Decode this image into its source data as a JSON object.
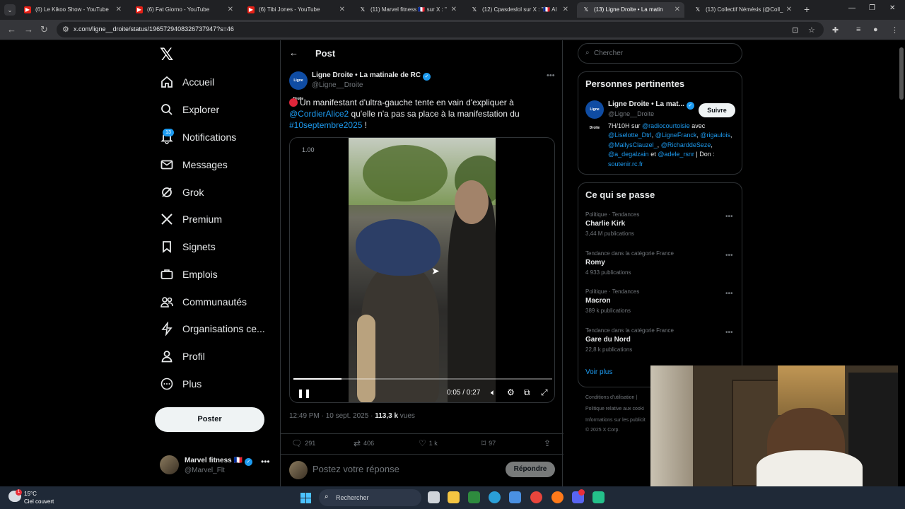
{
  "browser": {
    "tabs": [
      {
        "title": "(6) Le Kikoo Show - YouTube",
        "favicon_color": "#e62117"
      },
      {
        "title": "(6) Fat Giorno - YouTube",
        "favicon_color": "#e62117"
      },
      {
        "title": "(6) Tibi Jones - YouTube",
        "favicon_color": "#e62117"
      },
      {
        "title": "(11) Marvel fitness 🇫🇷 sur X : \"",
        "favicon_color": "#000000"
      },
      {
        "title": "(12) Cpasdeslol sur X : \"🇫🇷 Al",
        "favicon_color": "#000000"
      },
      {
        "title": "(13) Ligne Droite • La matin",
        "favicon_color": "#000000"
      },
      {
        "title": "(13) Collectif Némésis (@Coll_",
        "favicon_color": "#000000"
      }
    ],
    "active_tab_index": 5,
    "url": "x.com/ligne__droite/status/1965729408326737947?s=46"
  },
  "sidebar": {
    "items": [
      {
        "label": "Accueil",
        "icon": "home-icon"
      },
      {
        "label": "Explorer",
        "icon": "search-icon"
      },
      {
        "label": "Notifications",
        "icon": "bell-icon"
      },
      {
        "label": "Messages",
        "icon": "mail-icon"
      },
      {
        "label": "Grok",
        "icon": "grok-icon"
      },
      {
        "label": "Premium",
        "icon": "x-logo-icon"
      },
      {
        "label": "Signets",
        "icon": "bookmark-icon"
      },
      {
        "label": "Emplois",
        "icon": "briefcase-icon"
      },
      {
        "label": "Communautés",
        "icon": "people-icon"
      },
      {
        "label": "Organisations ce...",
        "icon": "lightning-icon"
      },
      {
        "label": "Profil",
        "icon": "person-icon"
      },
      {
        "label": "Plus",
        "icon": "more-circle-icon"
      }
    ],
    "notifications_badge": "13",
    "post_button": "Poster",
    "account": {
      "name": "Marvel fitness 🇫🇷",
      "handle": "@Marvel_Flt"
    }
  },
  "main": {
    "header_title": "Post",
    "tweet": {
      "author_name": "Ligne Droite • La matinale de RC",
      "author_handle": "@Ligne__Droite",
      "avatar_text": "Ligne Droite",
      "text_part1": "Un manifestant d'ultra-gauche tente en vain d'expliquer à ",
      "mention": "@CordierAlice2",
      "text_part2": " qu'elle n'a pas sa place à la manifestation du ",
      "hashtag": "#10septembre2025",
      "text_part3": " !",
      "video": {
        "playback_rate": "1.00",
        "time": "0:05 / 0:27",
        "progress": 0.185
      },
      "time_date": "12:49 PM · 10 sept. 2025 · ",
      "views_count": "113,3 k",
      "views_label": " vues",
      "stats": {
        "replies": "291",
        "reposts": "406",
        "likes": "1 k",
        "bookmarks": "97"
      }
    },
    "reply": {
      "placeholder": "Postez votre réponse",
      "button": "Répondre"
    }
  },
  "right": {
    "search_placeholder": "Chercher",
    "relevant": {
      "title": "Personnes pertinentes",
      "name": "Ligne Droite • La mat...",
      "handle": "@Ligne__Droite",
      "follow_button": "Suivre",
      "avatar_text": "Ligne Droite",
      "bio_1": "7H/10H sur ",
      "bio_link1": "@radiocourtoisie",
      "bio_2": " avec ",
      "bio_link2": "@Liselotte_Dtrl",
      "bio_3": ", ",
      "bio_link3": "@LigneFranck",
      "bio_4": ", ",
      "bio_link4": "@rigaulois",
      "bio_5": ", ",
      "bio_link5": "@MallysClauzel_",
      "bio_6": ", ",
      "bio_link6": "@RicharddeSeze",
      "bio_7": ", ",
      "bio_link7": "@a_degalzain",
      "bio_8": " et ",
      "bio_link8": "@adele_rsnr",
      "bio_9": " | Don : ",
      "bio_link9": "soutenir.rc.fr"
    },
    "trends": {
      "title": "Ce qui se passe",
      "items": [
        {
          "meta": "Politique · Tendances",
          "name": "Charlie Kirk",
          "count": "3,44 M publications"
        },
        {
          "meta": "Tendance dans la catégorie France",
          "name": "Romy",
          "count": "4 933 publications"
        },
        {
          "meta": "Politique · Tendances",
          "name": "Macron",
          "count": "389 k publications"
        },
        {
          "meta": "Tendance dans la catégorie France",
          "name": "Gare du Nord",
          "count": "22,8 k publications"
        }
      ],
      "more": "Voir plus"
    },
    "footer": [
      "Conditions d'utilisation  |",
      "Politique relative aux cooki",
      "Informations sur les publicit",
      "© 2025 X Corp."
    ]
  },
  "taskbar": {
    "temperature": "15°C",
    "weather": "Ciel couvert",
    "weather_badge": "1",
    "search": "Rechercher"
  }
}
